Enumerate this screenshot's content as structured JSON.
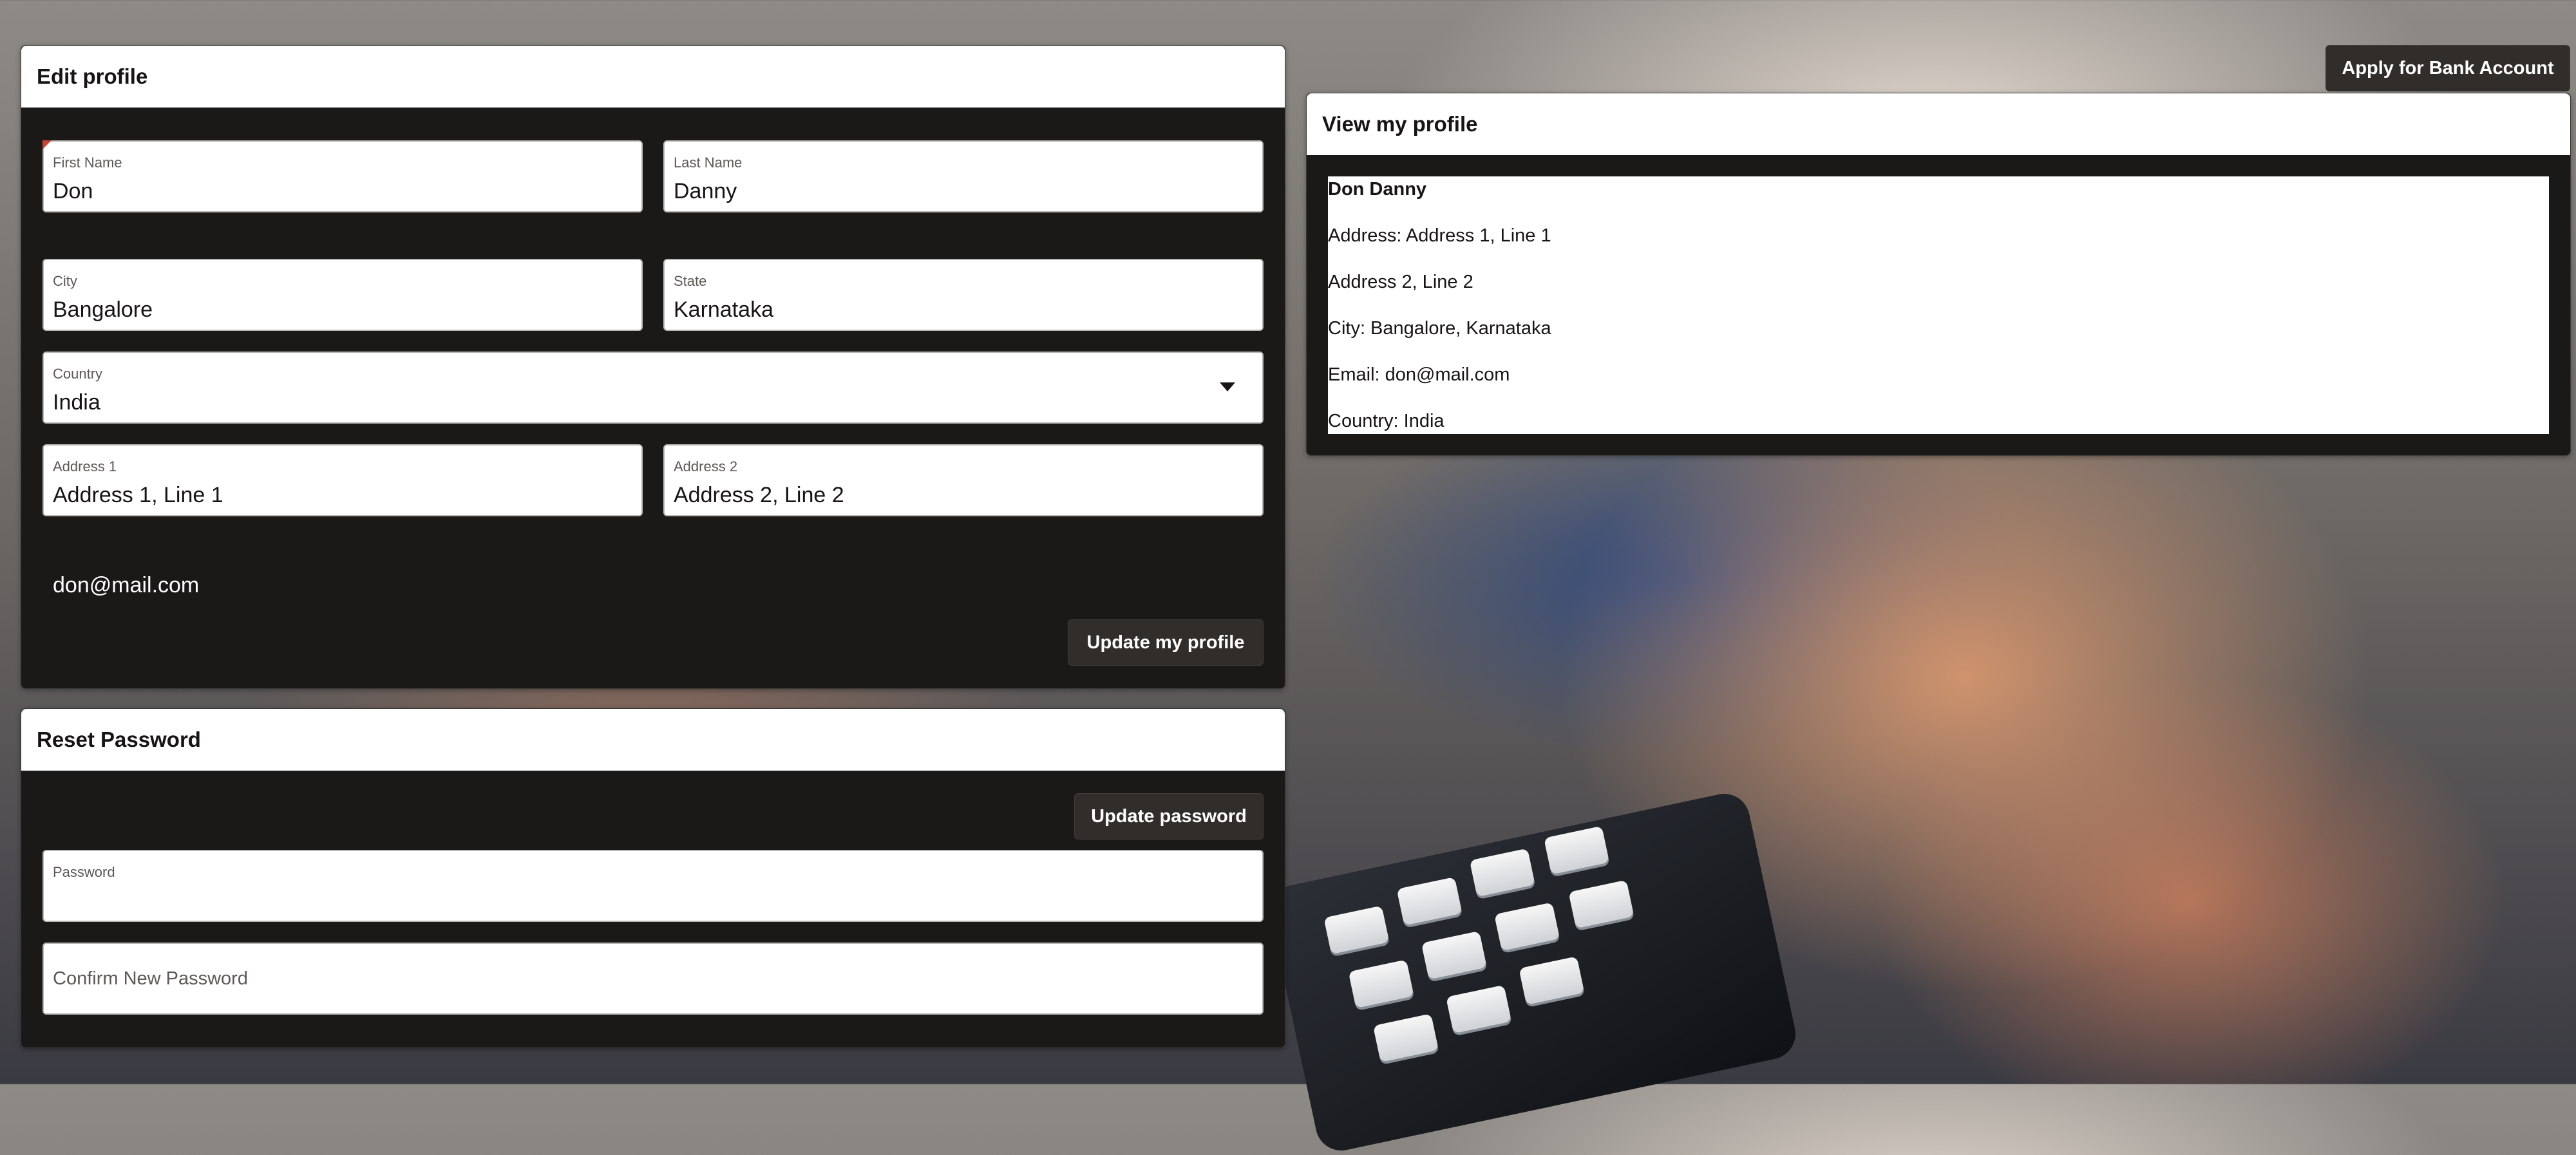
{
  "header": {
    "apply_button": "Apply for Bank Account"
  },
  "edit_profile": {
    "title": "Edit profile",
    "first_name": {
      "label": "First Name",
      "value": "Don"
    },
    "last_name": {
      "label": "Last Name",
      "value": "Danny"
    },
    "city": {
      "label": "City",
      "value": "Bangalore"
    },
    "state": {
      "label": "State",
      "value": "Karnataka"
    },
    "country": {
      "label": "Country",
      "value": "India"
    },
    "address1": {
      "label": "Address 1",
      "value": "Address 1, Line 1"
    },
    "address2": {
      "label": "Address 2",
      "value": "Address 2, Line 2"
    },
    "email": "don@mail.com",
    "update_button": "Update my profile"
  },
  "reset_password": {
    "title": "Reset Password",
    "update_button": "Update password",
    "password": {
      "label": "Password",
      "value": ""
    },
    "confirm_password": {
      "placeholder": "Confirm New Password"
    }
  },
  "view_profile": {
    "title": "View my profile",
    "name": "Don Danny",
    "lines": [
      "Address: Address 1, Line 1",
      "Address 2, Line 2",
      "City: Bangalore, Karnataka",
      "Email: don@mail.com",
      "Country: India"
    ]
  },
  "colors": {
    "panel_bg": "#1a1918",
    "button_bg": "#312d2a",
    "required": "#c74634"
  }
}
